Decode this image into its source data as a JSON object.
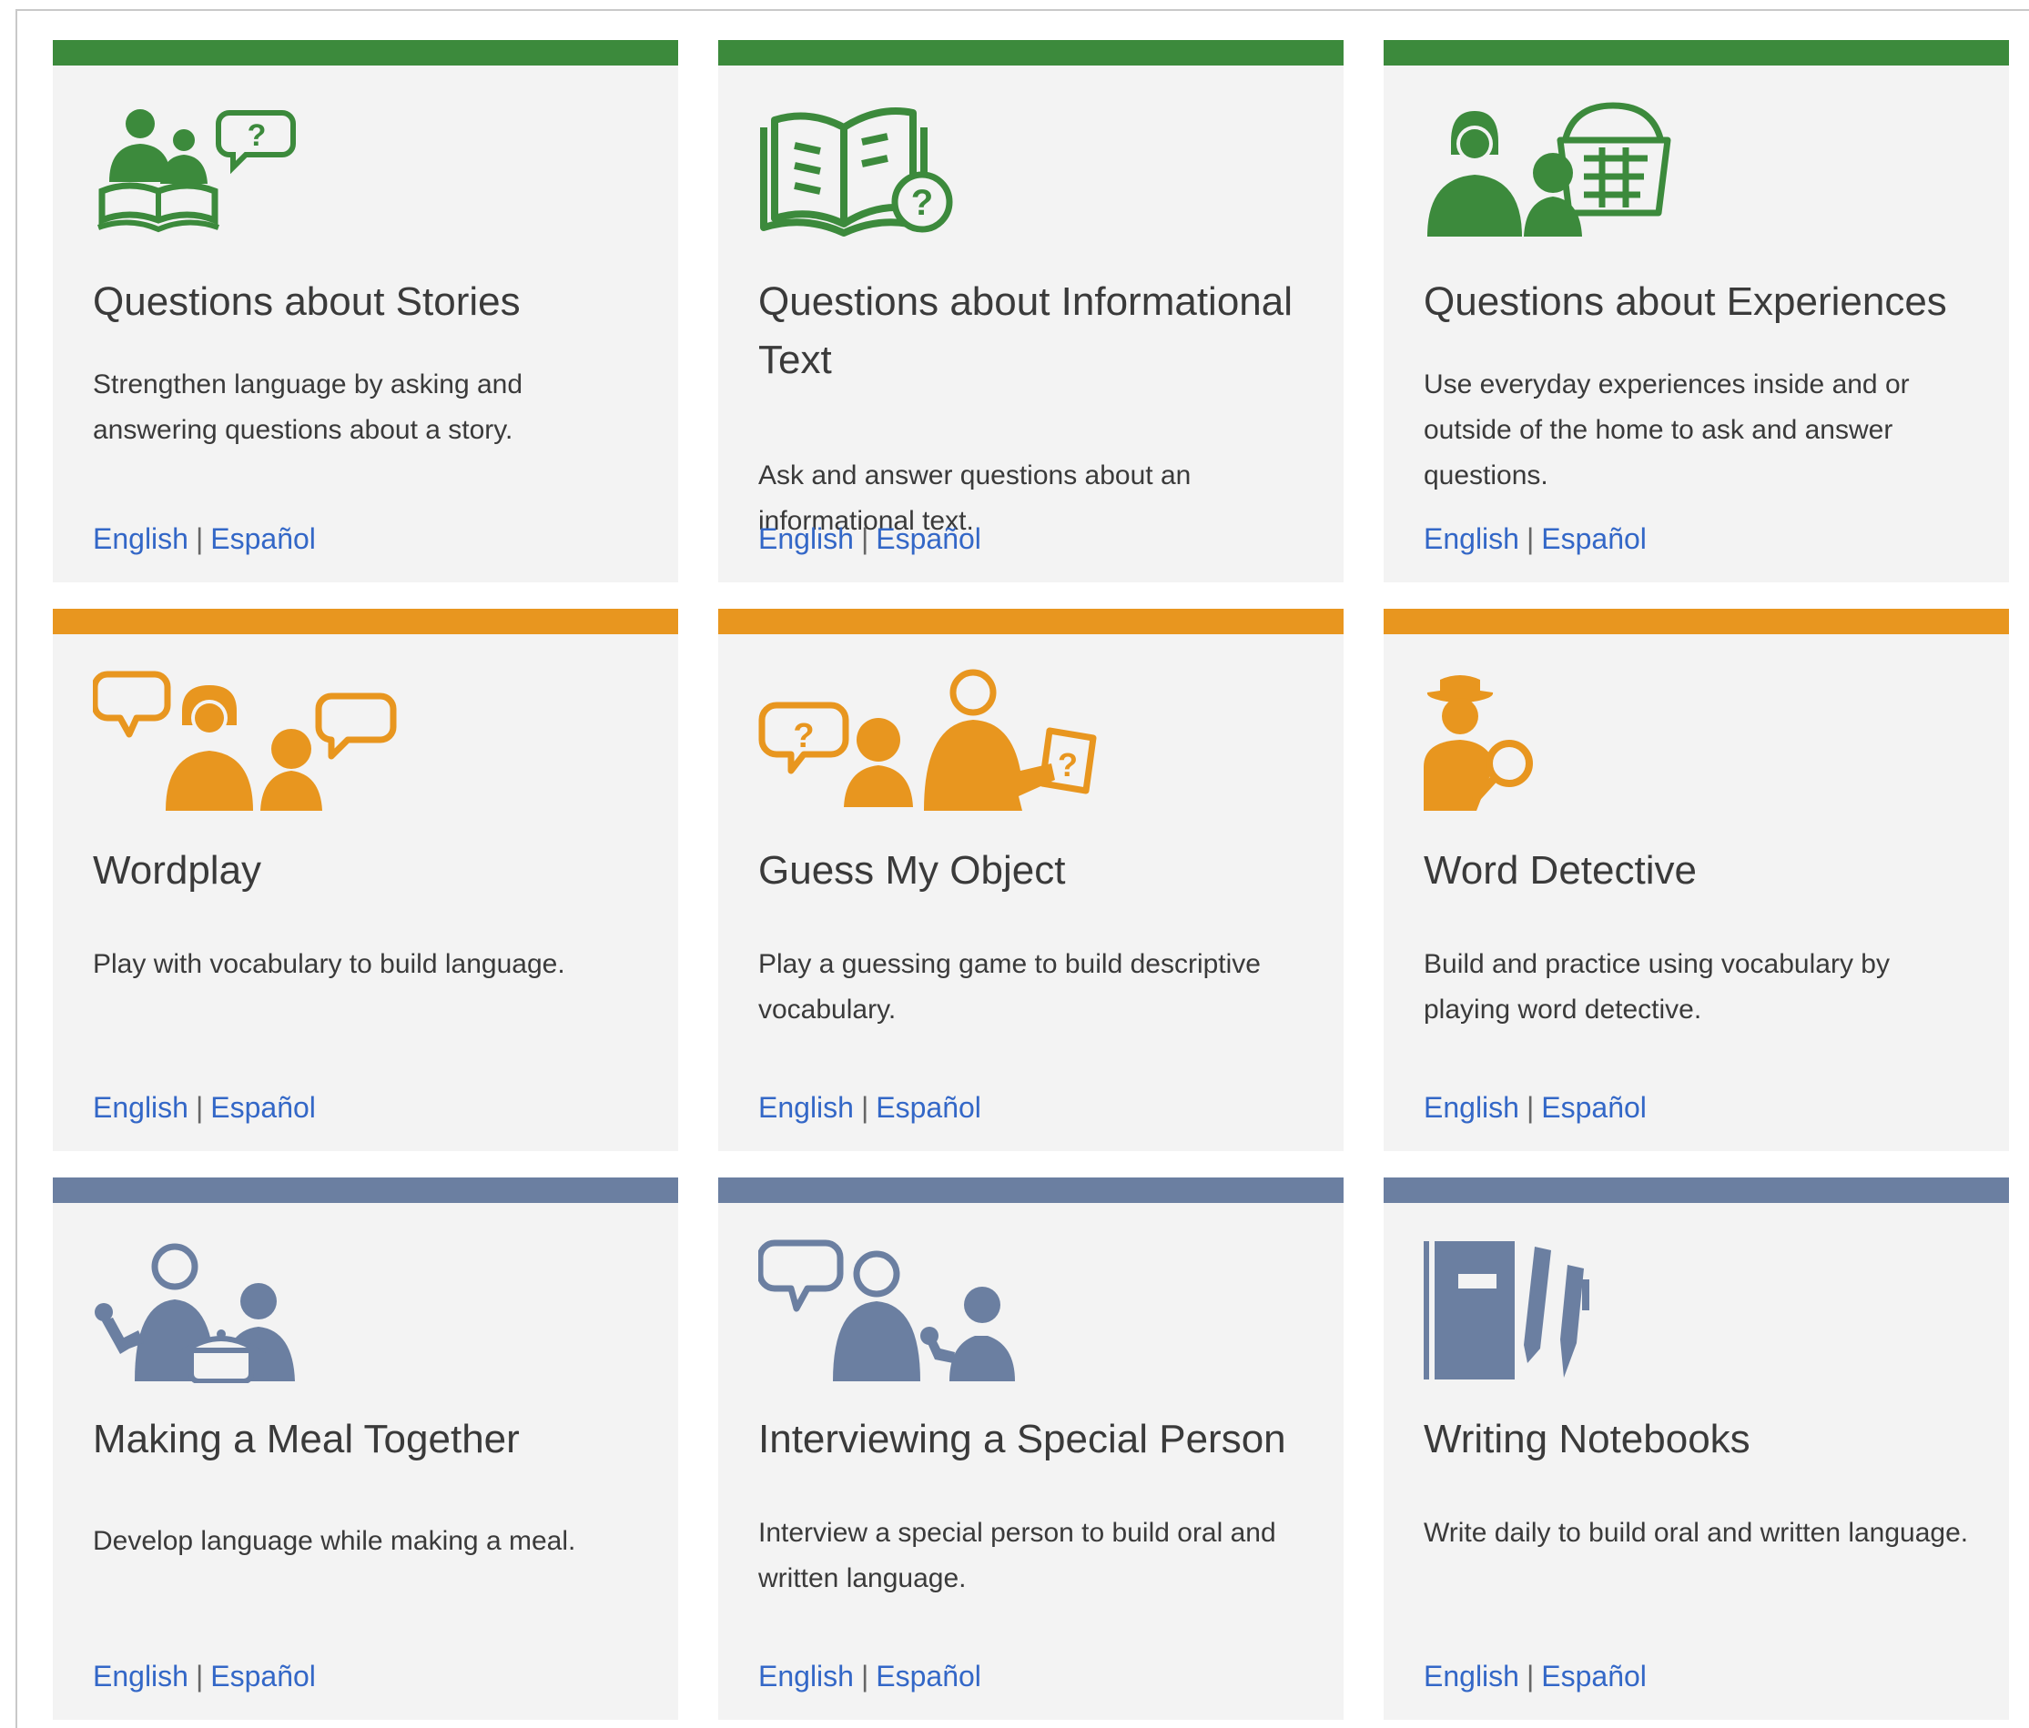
{
  "colors": {
    "green": "#3c8a3c",
    "orange": "#e8961f",
    "slate": "#6b7fa1",
    "card_bg": "#f3f3f3",
    "link": "#3367c7"
  },
  "link_separator": "|",
  "cards": [
    {
      "title": "Questions about Stories",
      "description": "Strengthen language by asking and answering questions about a story.",
      "icon": "parent-child-reading-book-question-icon",
      "accent": "green",
      "english_label": "English",
      "espanol_label": "Español"
    },
    {
      "title": "Questions about Informational Text",
      "description": "Ask and answer questions about an informational text.",
      "icon": "open-book-question-icon",
      "accent": "green",
      "english_label": "English",
      "espanol_label": "Español"
    },
    {
      "title": "Questions about Experiences",
      "description": "Use everyday experiences inside and or outside of the home to ask and answer questions.",
      "icon": "people-shopping-basket-icon",
      "accent": "green",
      "english_label": "English",
      "espanol_label": "Español"
    },
    {
      "title": "Wordplay",
      "description": "Play with vocabulary to build language.",
      "icon": "people-speech-bubbles-icon",
      "accent": "orange",
      "english_label": "English",
      "espanol_label": "Español"
    },
    {
      "title": "Guess My Object",
      "description": "Play a guessing game to build descriptive vocabulary.",
      "icon": "guessing-game-card-icon",
      "accent": "orange",
      "english_label": "English",
      "espanol_label": "Español"
    },
    {
      "title": "Word Detective",
      "description": "Build and practice using vocabulary by playing word detective.",
      "icon": "detective-magnifier-icon",
      "accent": "orange",
      "english_label": "English",
      "espanol_label": "Español"
    },
    {
      "title": "Making a Meal Together",
      "description": "Develop language while making a meal.",
      "icon": "cooking-together-pot-icon",
      "accent": "slate",
      "english_label": "English",
      "espanol_label": "Español"
    },
    {
      "title": "Interviewing a Special Person",
      "description": "Interview a special person to build oral and written language.",
      "icon": "interview-microphone-icon",
      "accent": "slate",
      "english_label": "English",
      "espanol_label": "Español"
    },
    {
      "title": "Writing Notebooks",
      "description": "Write daily to build oral and written language.",
      "icon": "notebook-pencil-pen-icon",
      "accent": "slate",
      "english_label": "English",
      "espanol_label": "Español"
    }
  ]
}
